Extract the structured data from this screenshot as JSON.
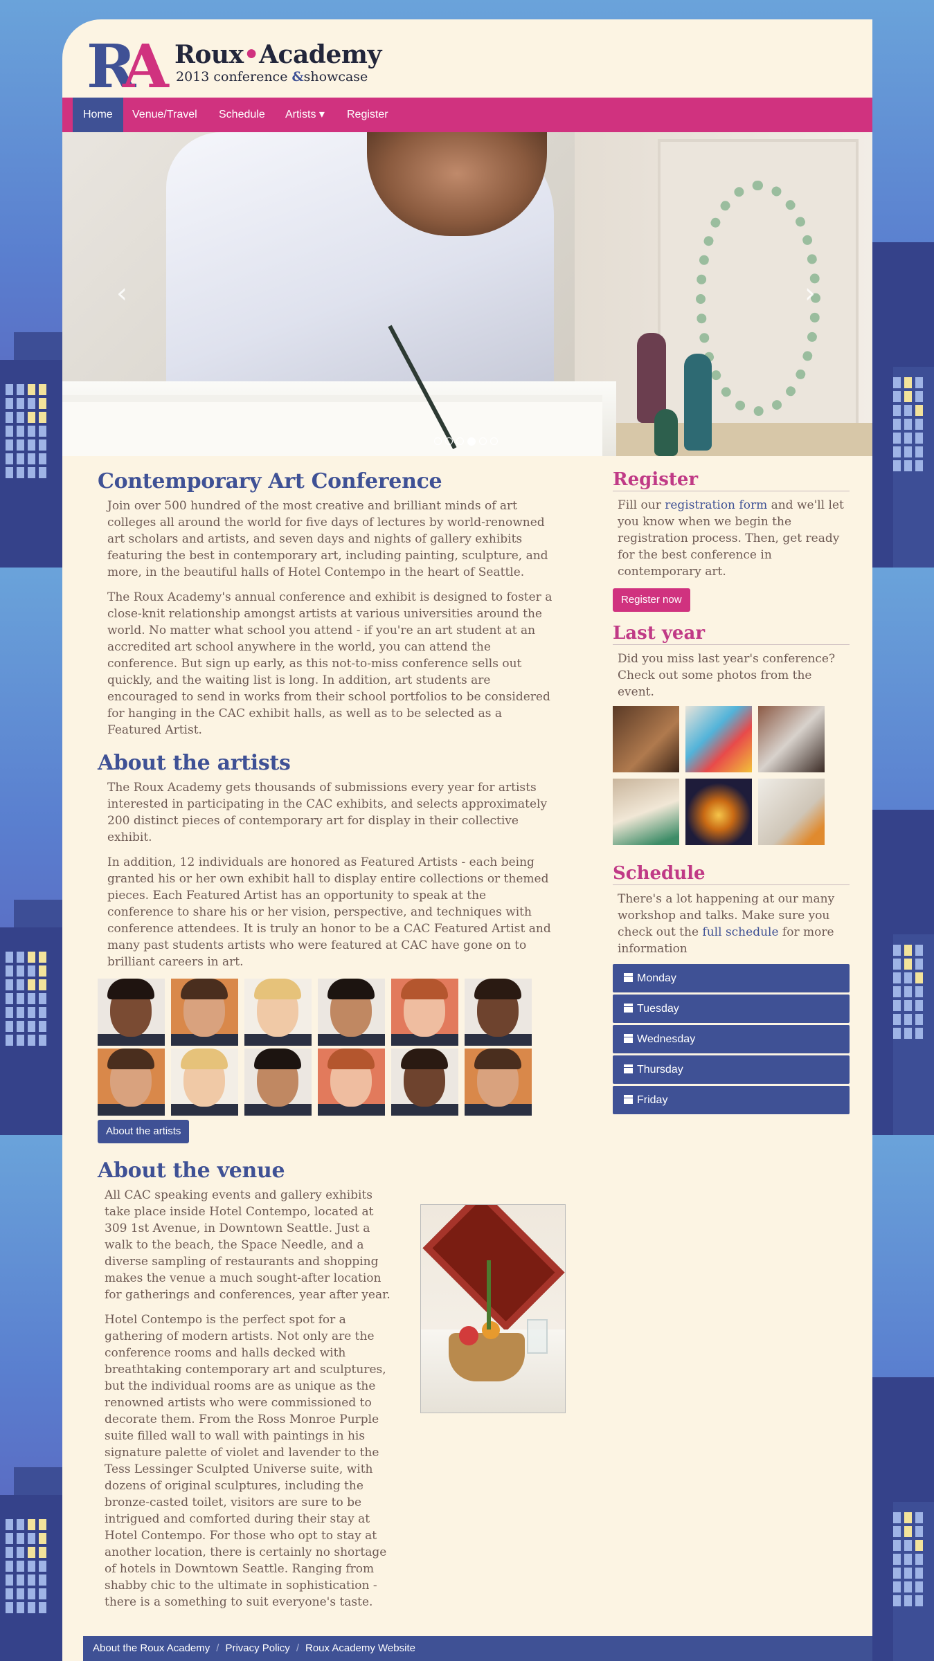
{
  "brand": {
    "mark_r": "R",
    "mark_a": "A",
    "title_left": "Roux",
    "title_dot": "•",
    "title_right": "Academy",
    "subtitle_year": "2013 conference ",
    "subtitle_amp": "&",
    "subtitle_end": "showcase",
    "colors": {
      "blue": "#3f5195",
      "pink": "#d0327f",
      "cream": "#fcf4e3"
    }
  },
  "nav": {
    "items": [
      {
        "label": "Home",
        "active": true
      },
      {
        "label": "Venue/Travel"
      },
      {
        "label": "Schedule"
      },
      {
        "label": "Artists ▾"
      },
      {
        "label": "Register"
      }
    ]
  },
  "carousel": {
    "prev_icon": "chevron-left-icon",
    "next_icon": "chevron-right-icon",
    "prev": "‹",
    "next": "›",
    "slide_count": 6,
    "active_slide": 3
  },
  "main": {
    "conference_title": "Contemporary Art Conference",
    "conference_p1": "Join over 500 hundred of the most creative and brilliant minds of art colleges all around the world for five days of lectures by world-renowned art scholars and artists, and seven days and nights of gallery exhibits featuring the best in contemporary art, including painting, sculpture, and more, in the beautiful halls of Hotel Contempo in the heart of Seattle.",
    "conference_p2": "The Roux Academy's annual conference and exhibit is designed to foster a close-knit relationship amongst artists at various universities around the world. No matter what school you attend - if you're an art student at an accredited art school anywhere in the world, you can attend the conference. But sign up early, as this not-to-miss conference sells out quickly, and the waiting list is long. In addition, art students are encouraged to send in works from their school portfolios to be considered for hanging in the CAC exhibit halls, as well as to be selected as a Featured Artist.",
    "artists_title": "About the artists",
    "artists_p1": "The Roux Academy gets thousands of submissions every year for artists interested in participating in the CAC exhibits, and selects approximately 200 distinct pieces of contemporary art for display in their collective exhibit.",
    "artists_p2": "In addition, 12 individuals are honored as Featured Artists - each being granted his or her own exhibit hall to display entire collections or themed pieces. Each Featured Artist has an opportunity to speak at the conference to share his or her vision, perspective, and techniques with conference attendees. It is truly an honor to be a CAC Featured Artist and many past students artists who were featured at CAC have gone on to brilliant careers in art.",
    "artists_button": "About the artists",
    "venue_title": "About the venue",
    "venue_p1": "All CAC speaking events and gallery exhibits take place inside Hotel Contempo, located at 309 1st Avenue, in Downtown Seattle. Just a walk to the beach, the Space Needle, and a diverse sampling of restaurants and shopping makes the venue a much sought-after location for gatherings and conferences, year after year.",
    "venue_p2": "Hotel Contempo is the perfect spot for a gathering of modern artists. Not only are the conference rooms and halls decked with breathtaking contemporary art and sculptures, but the individual rooms are as unique as the renowned artists who were commissioned to decorate them. From the Ross Monroe Purple suite filled wall to wall with paintings in his signature palette of violet and lavender to the Tess Lessinger Sculpted Universe suite, with dozens of original sculptures, including the bronze-casted toilet, visitors are sure to be intrigued and comforted during their stay at Hotel Contempo. For those who opt to stay at another location, there is certainly no shortage of hotels in Downtown Seattle. Ranging from shabby chic to the ultimate in sophistication - there is a something to suit everyone's taste."
  },
  "sidebar": {
    "register_title": "Register",
    "register_pre": "Fill our ",
    "register_link": "registration form",
    "register_post": " and we'll let you know when we begin the registration process. Then, get ready for the best conference in contemporary art.",
    "register_button": "Register now",
    "lastyear_title": "Last year",
    "lastyear_text": "Did you miss last year's conference? Check out some photos from the event.",
    "schedule_title": "Schedule",
    "schedule_pre": "There's a lot happening at our many workshop and talks. Make sure you check out the ",
    "schedule_link": "full schedule",
    "schedule_post": " for more information",
    "days": [
      "Monday",
      "Tuesday",
      "Wednesday",
      "Thursday",
      "Friday"
    ],
    "day_icon": "calendar-icon"
  },
  "footer": {
    "links": [
      "About the Roux Academy",
      "Privacy Policy",
      "Roux Academy Website"
    ],
    "separator": "/"
  }
}
